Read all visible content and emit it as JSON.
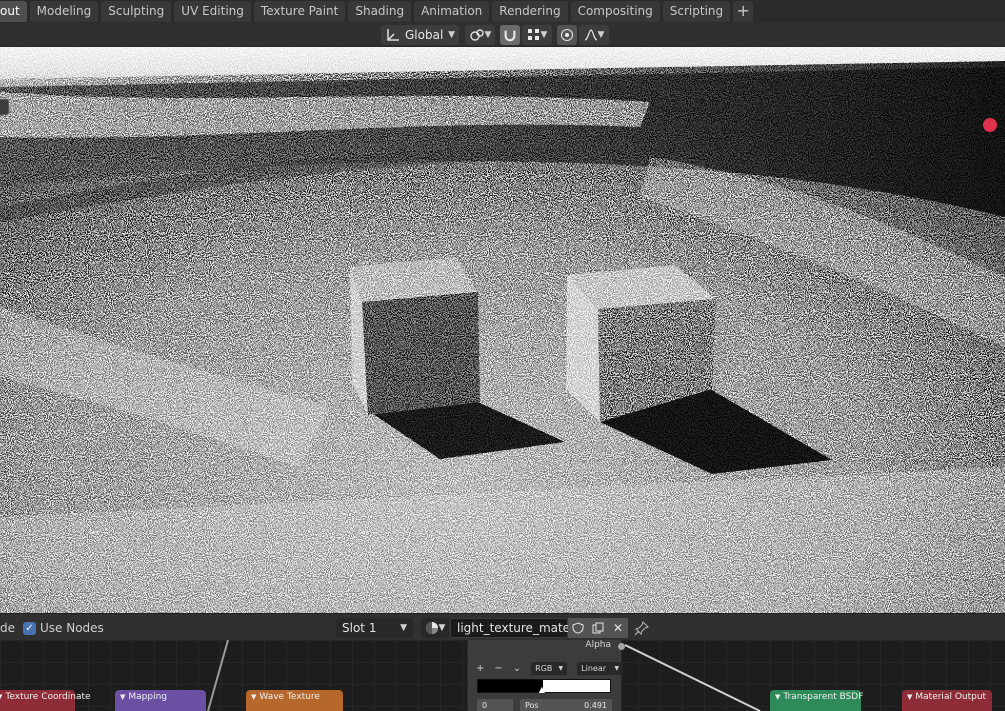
{
  "workspace_tabs": [
    "out",
    "Modeling",
    "Sculpting",
    "UV Editing",
    "Texture Paint",
    "Shading",
    "Animation",
    "Rendering",
    "Compositing",
    "Scripting"
  ],
  "add_tab": "+",
  "viewport_header": {
    "orientation_label": "Global",
    "icons": [
      "transform-orientation-icon",
      "pivot-link-icon",
      "snap-magnet-icon",
      "snap-grid-icon",
      "proportional-edit-icon",
      "falloff-curve-icon"
    ]
  },
  "node_header": {
    "mode_fragment": "de",
    "use_nodes_label": "Use Nodes",
    "use_nodes_checked": true,
    "slot_label": "Slot 1",
    "material_name": "light_texture_materi..."
  },
  "nodes": [
    {
      "label": "Texture Coordinate",
      "color": "#8e2c38"
    },
    {
      "label": "Mapping",
      "color": "#6a4fa3"
    },
    {
      "label": "Wave Texture",
      "color": "#b5672c"
    },
    {
      "label": "Transparent BSDF",
      "color": "#2f8a5a"
    },
    {
      "label": "Material Output",
      "color": "#8e2c38"
    }
  ],
  "color_ramp": {
    "alpha_label": "Alpha",
    "add_label": "+",
    "remove_label": "−",
    "menu_label": "⌄",
    "color_mode": "RGB",
    "interpolation": "Linear",
    "index_value": "0",
    "pos_label": "Pos",
    "pos_value": "0.491",
    "split_fraction": 0.491
  },
  "colors": {
    "tab_active": "#4f4f4f",
    "checkbox": "#4772b3",
    "gizmo_dot": "#e0314d"
  }
}
